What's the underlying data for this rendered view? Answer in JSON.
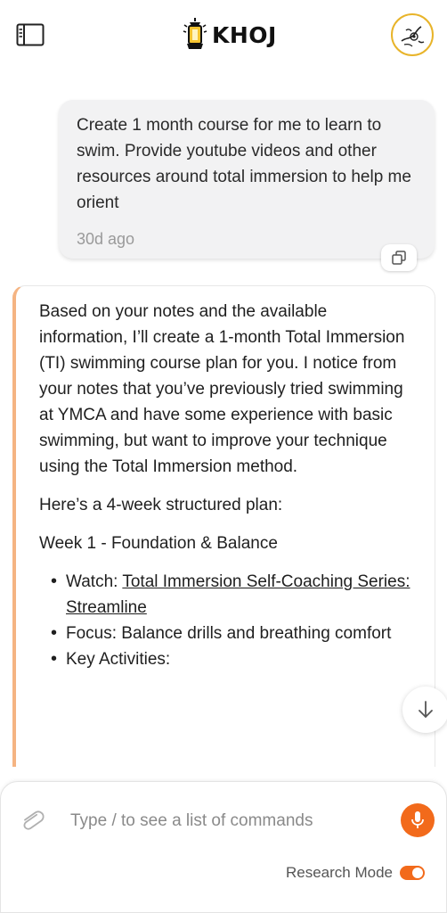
{
  "app": {
    "logo_text": "KHOJ"
  },
  "icons": {
    "sidebar": "sidebar-toggle-icon",
    "logo": "lantern-icon",
    "avatar": "user-avatar-icon",
    "copy": "copy-icon",
    "scroll": "arrow-down-icon",
    "attach": "paperclip-icon",
    "mic": "microphone-icon"
  },
  "colors": {
    "accent": "#f26a1b",
    "bot_border": "#f5b482",
    "avatar_ring": "#e8b42a"
  },
  "user_message": {
    "text": "Create 1 month course for me to learn to swim. Provide youtube videos and other resources around total immersion to help me orient",
    "time": "30d ago"
  },
  "bot_message": {
    "intro": "Based on your notes and the available information, I’ll create a 1-month Total Immersion (TI) swimming course plan for you. I notice from your notes that you’ve previously tried swimming at YMCA and have some experience with basic swimming, but want to improve your technique using the Total Immersion method.",
    "plan_intro": "Here’s a 4-week structured plan:",
    "week1_title": "Week 1 - Foundation & Balance",
    "items": [
      {
        "label": "Watch: ",
        "link": "Total Immersion Self-Coaching Series: Streamline"
      },
      {
        "label": "Focus: Balance drills and breathing comfort"
      },
      {
        "label": "Key Activities:"
      }
    ]
  },
  "composer": {
    "placeholder": "Type / to see a list of commands",
    "research_label": "Research Mode",
    "research_on": true
  }
}
